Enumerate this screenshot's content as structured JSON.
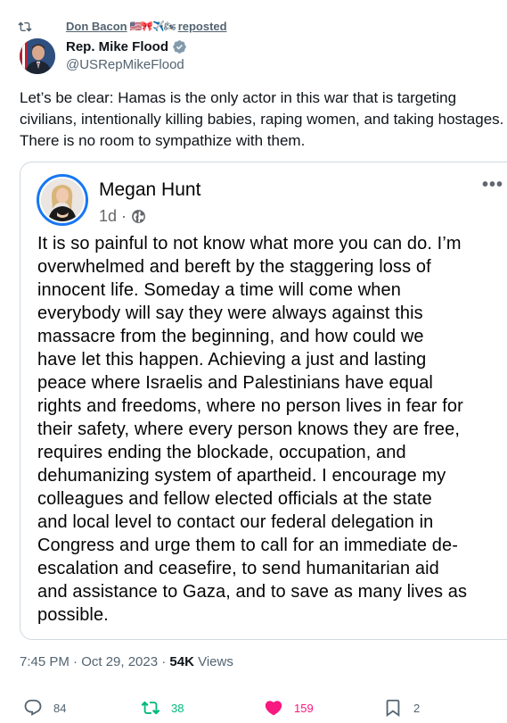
{
  "repost_bar": {
    "reposter_name": "Don Bacon",
    "flags": "🇺🇸🎀✈️🏍",
    "label": "reposted"
  },
  "author": {
    "name": "Rep. Mike Flood",
    "handle": "@USRepMikeFlood",
    "verified_color": "#829aab"
  },
  "tweet": {
    "text": "Let’s be clear: Hamas is the only actor in this war that is targeting\ncivilians, intentionally killing babies, raping women, and taking hostages.\nThere is no room to sympathize with them."
  },
  "quote": {
    "name": "Megan Hunt",
    "age": "1d",
    "separator": "·",
    "more": "•••",
    "body": "It is so painful to not know what more you can do. I’m\noverwhelmed and bereft by the staggering loss of\ninnocent life. Someday a time will come when\neverybody will say they were always against this\nmassacre from the beginning, and how could we\nhave let this happen. Achieving a just and lasting\npeace where Israelis and Palestinians have equal\nrights and freedoms, where no person lives in fear for\ntheir safety, where every person knows they are free,\nrequires ending the blockade, occupation, and\ndehumanizing system of apartheid. I encourage my\ncolleagues and fellow elected officials at the state\nand local level to contact our federal delegation in\nCongress and urge them to call for an immediate de-\nescalation and ceasefire, to send humanitarian aid\nand assistance to Gaza, and to save as many lives as\npossible."
  },
  "meta": {
    "time": "7:45 PM · Oct 29, 2023 · ",
    "views_count": "54K",
    "views_label": " Views"
  },
  "actions": {
    "replies": "84",
    "reposts": "38",
    "likes": "159",
    "bookmarks": "2"
  },
  "colors": {
    "repost_green": "#00ba7c",
    "like_pink": "#f91880",
    "facebook_blue": "#1877f2"
  }
}
